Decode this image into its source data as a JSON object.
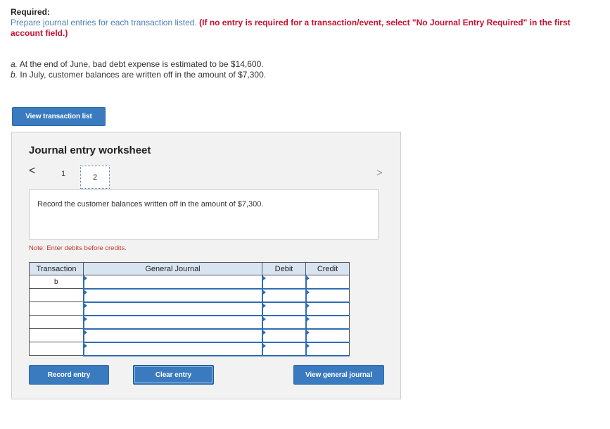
{
  "header": {
    "required_label": "Required:",
    "instruction_text": "Prepare journal entries for each transaction listed.",
    "instruction_emphasis": "(If no entry is required for a transaction/event, select \"No Journal Entry Required\" in the first account field.)"
  },
  "transactions": [
    {
      "letter": "a.",
      "text": "At the end of June, bad debt expense is estimated to be $14,600."
    },
    {
      "letter": "b.",
      "text": "In July, customer balances are written off in the amount of $7,300."
    }
  ],
  "buttons": {
    "view_transaction_list": "View transaction list",
    "record_entry": "Record entry",
    "clear_entry": "Clear entry",
    "view_general_journal": "View general journal"
  },
  "worksheet": {
    "title": "Journal entry worksheet",
    "pager": {
      "prev": "<",
      "next": ">",
      "pages": [
        "1",
        "2"
      ],
      "current": "2"
    },
    "prompt": "Record the customer balances written off in the amount of $7,300.",
    "note": "Note: Enter debits before credits."
  },
  "journal_table": {
    "headers": [
      "Transaction",
      "General Journal",
      "Debit",
      "Credit"
    ],
    "rows": [
      {
        "transaction": "b",
        "account": "",
        "debit": "",
        "credit": ""
      },
      {
        "transaction": "",
        "account": "",
        "debit": "",
        "credit": ""
      },
      {
        "transaction": "",
        "account": "",
        "debit": "",
        "credit": ""
      },
      {
        "transaction": "",
        "account": "",
        "debit": "",
        "credit": ""
      },
      {
        "transaction": "",
        "account": "",
        "debit": "",
        "credit": ""
      },
      {
        "transaction": "",
        "account": "",
        "debit": "",
        "credit": ""
      }
    ]
  },
  "colors": {
    "primary_button": "#3a7abf",
    "instruction_blue": "#4a7fb5",
    "emphasis_red": "#c8102e",
    "worksheet_bg": "#f2f2f2",
    "table_header_bg": "#d9e4f2"
  }
}
